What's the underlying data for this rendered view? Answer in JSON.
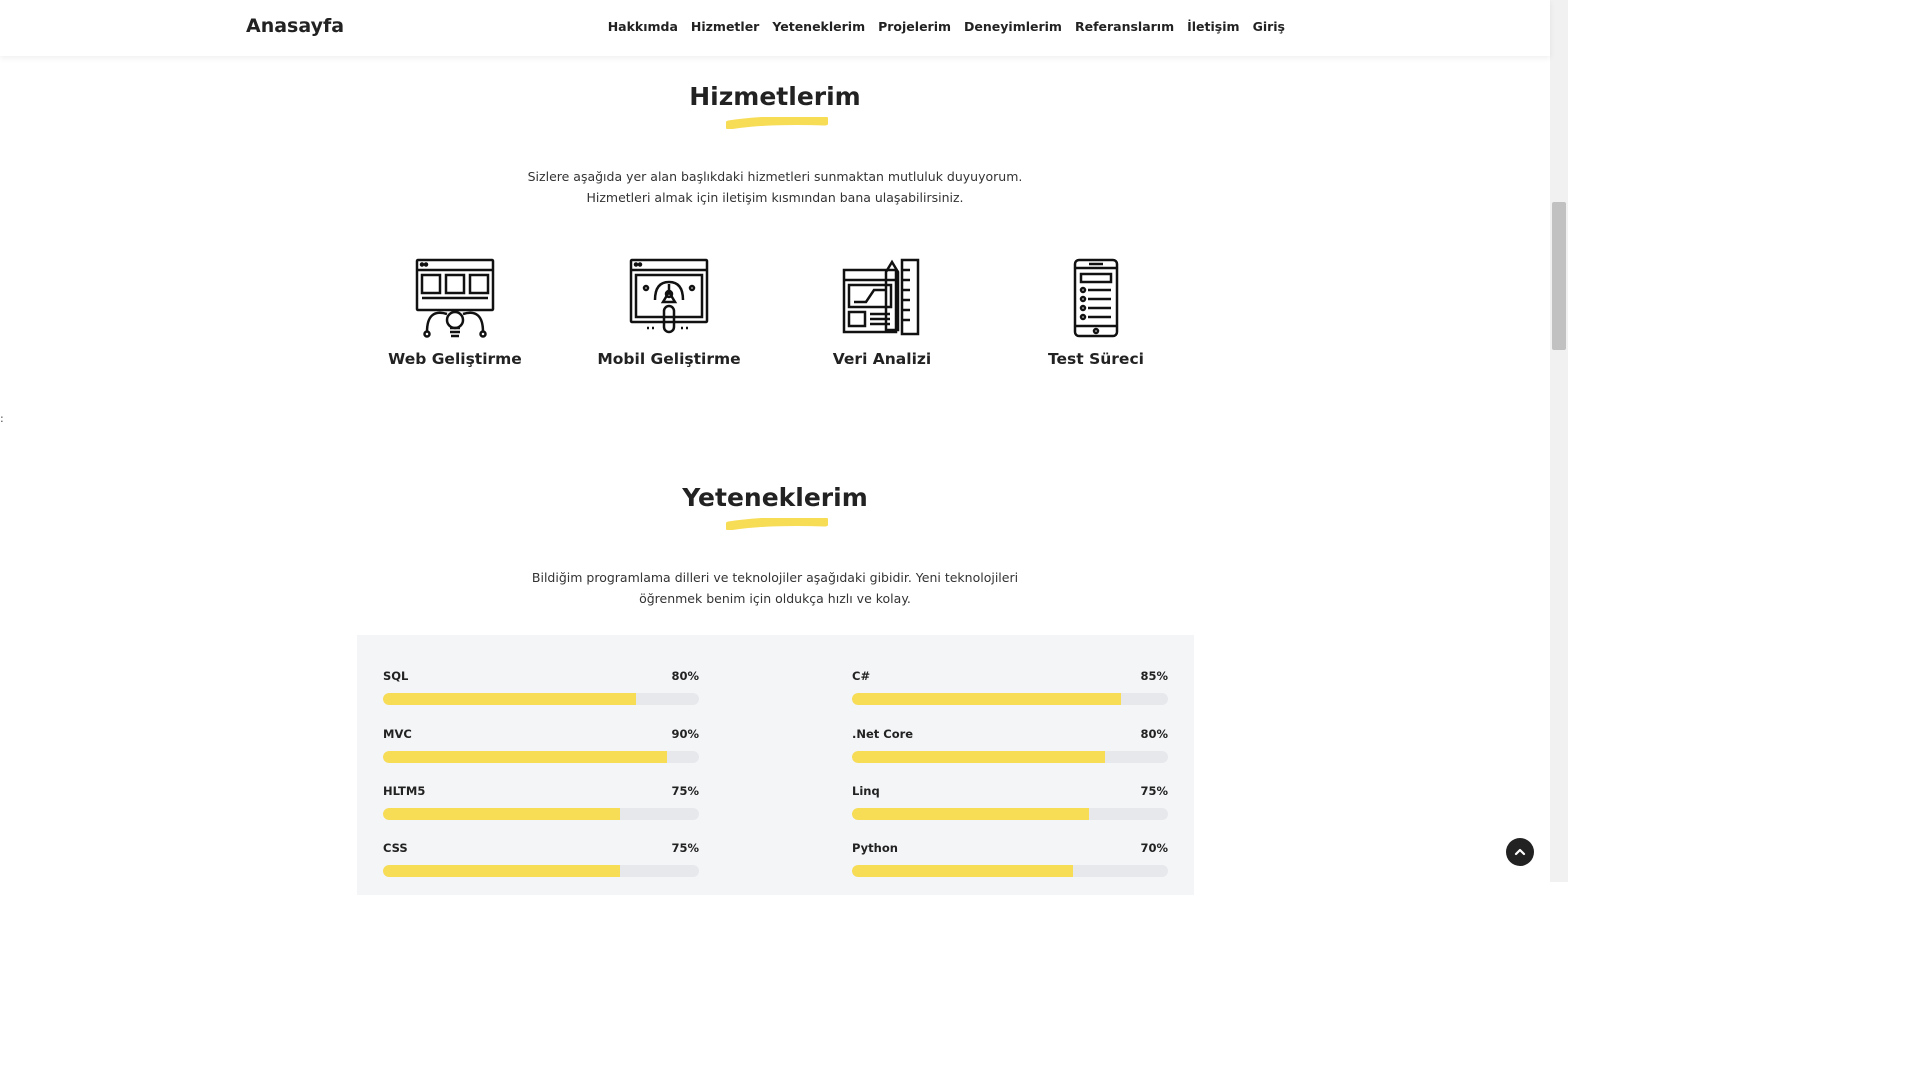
{
  "nav": {
    "brand": "Anasayfa",
    "links": [
      "Hakkımda",
      "Hizmetler",
      "Yeteneklerim",
      "Projelerim",
      "Deneyimlerim",
      "Referanslarım",
      "İletişim",
      "Giriş"
    ]
  },
  "services": {
    "title": "Hizmetlerim",
    "desc_line1": "Sizlere aşağıda yer alan başlıkdaki hizmetleri sunmaktan mutluluk duyuyorum.",
    "desc_line2": "Hizmetleri almak için iletişim kısmından bana ulaşabilirsiniz.",
    "items": [
      {
        "label": "Web Geliştirme",
        "icon": "web-development-icon"
      },
      {
        "label": "Mobil Geliştirme",
        "icon": "mobile-development-icon"
      },
      {
        "label": "Veri Analizi",
        "icon": "data-analysis-icon"
      },
      {
        "label": "Test Süreci",
        "icon": "test-process-icon"
      }
    ]
  },
  "stray_char": ":",
  "skills": {
    "title": "Yeteneklerim",
    "desc_line1": "Bildiğim programlama dilleri ve teknolojiler aşağıdaki gibidir. Yeni teknolojileri",
    "desc_line2": "öğrenmek benim için oldukça hızlı ve kolay.",
    "items": [
      {
        "name": "SQL",
        "percent_label": "80%",
        "level": 0.8
      },
      {
        "name": "C#",
        "percent_label": "85%",
        "level": 0.85
      },
      {
        "name": "MVC",
        "percent_label": "90%",
        "level": 0.9
      },
      {
        "name": ".Net Core",
        "percent_label": "80%",
        "level": 0.8
      },
      {
        "name": "HLTM5",
        "percent_label": "75%",
        "level": 0.75
      },
      {
        "name": "Linq",
        "percent_label": "75%",
        "level": 0.75
      },
      {
        "name": "CSS",
        "percent_label": "75%",
        "level": 0.75
      },
      {
        "name": "Python",
        "percent_label": "70%",
        "level": 0.7
      }
    ]
  },
  "colors": {
    "accent": "#f7dc55",
    "track": "#e6e8eb",
    "text": "#222222",
    "panel": "#f4f5f7"
  },
  "icons": {
    "back_to_top": "chevron-up-icon"
  }
}
